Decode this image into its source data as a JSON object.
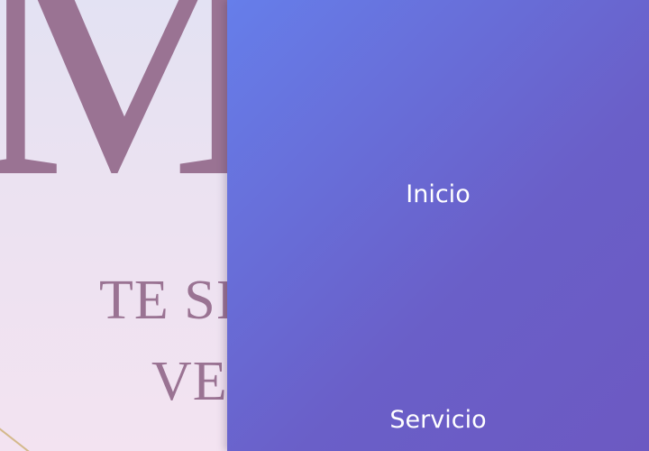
{
  "hero": {
    "monogram": "M",
    "line1": "TE SI",
    "line2": "VE"
  },
  "drawer": {
    "items": [
      {
        "label": "Inicio"
      },
      {
        "label": "Servicio"
      }
    ]
  },
  "colors": {
    "drawer_gradient_start": "#667eea",
    "drawer_gradient_end": "#6c59c2",
    "hero_text": "#9a7393",
    "background": "#ebe2f1",
    "accent_gold": "#d4b98c"
  }
}
